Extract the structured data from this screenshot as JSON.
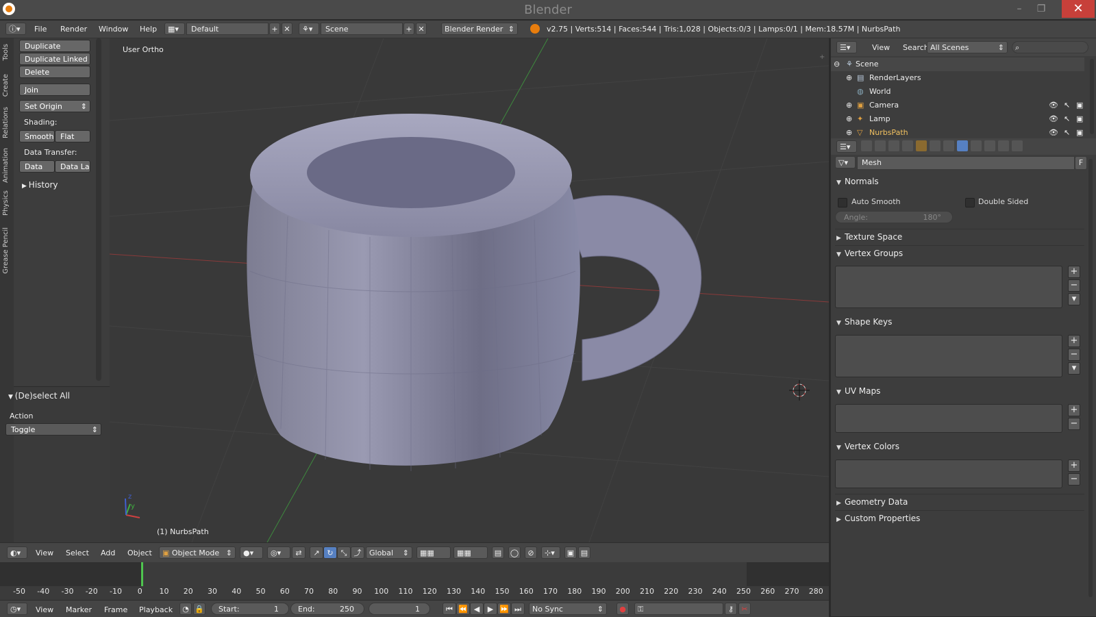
{
  "window": {
    "title": "Blender",
    "minimize_icon": "minimize-icon",
    "maximize_icon": "maximize-icon",
    "close_label": "✕"
  },
  "infobar": {
    "menus": [
      "File",
      "Render",
      "Window",
      "Help"
    ],
    "layout": "Default",
    "scene": "Scene",
    "engine": "Blender Render",
    "stats": "v2.75 | Verts:514 | Faces:544 | Tris:1,028 | Objects:0/3 | Lamps:0/1 | Mem:18.57M | NurbsPath"
  },
  "toolshelf": {
    "tabs": [
      "Tools",
      "Create",
      "Relations",
      "Animation",
      "Physics",
      "Grease Pencil"
    ],
    "duplicate": "Duplicate",
    "duplicate_linked": "Duplicate Linked",
    "delete": "Delete",
    "join": "Join",
    "set_origin": "Set Origin",
    "shading_label": "Shading:",
    "smooth": "Smooth",
    "flat": "Flat",
    "data_transfer_label": "Data Transfer:",
    "data": "Data",
    "data_layout": "Data La",
    "history": "History",
    "operator_title": "(De)select All",
    "action_label": "Action",
    "action_value": "Toggle"
  },
  "viewport": {
    "view_label": "User Ortho",
    "object_label": "(1) NurbsPath",
    "axis_y": "y",
    "axis_z": "z"
  },
  "viewheader": {
    "menus": [
      "View",
      "Select",
      "Add",
      "Object"
    ],
    "mode": "Object Mode",
    "orientation": "Global"
  },
  "timeline": {
    "ticks": [
      "-50",
      "-40",
      "-30",
      "-20",
      "-10",
      "0",
      "10",
      "20",
      "30",
      "40",
      "50",
      "60",
      "70",
      "80",
      "90",
      "100",
      "110",
      "120",
      "130",
      "140",
      "150",
      "160",
      "170",
      "180",
      "190",
      "200",
      "210",
      "220",
      "230",
      "240",
      "250",
      "260",
      "270",
      "280"
    ],
    "menus": [
      "View",
      "Marker",
      "Frame",
      "Playback"
    ],
    "start_label": "Start:",
    "start_value": "1",
    "end_label": "End:",
    "end_value": "250",
    "current_frame": "1",
    "sync": "No Sync"
  },
  "outliner": {
    "menus": [
      "View",
      "Search"
    ],
    "display": "All Scenes",
    "items": [
      {
        "label": "Scene",
        "icon": "scene-icon"
      },
      {
        "label": "RenderLayers",
        "icon": "render-layers-icon"
      },
      {
        "label": "World",
        "icon": "world-icon"
      },
      {
        "label": "Camera",
        "icon": "camera-icon"
      },
      {
        "label": "Lamp",
        "icon": "lamp-icon"
      },
      {
        "label": "NurbsPath",
        "icon": "curve-icon"
      }
    ]
  },
  "properties": {
    "mesh_name": "Mesh",
    "fake_user": "F",
    "normals": "Normals",
    "auto_smooth": "Auto Smooth",
    "double_sided": "Double Sided",
    "angle_label": "Angle:",
    "angle_value": "180°",
    "texture_space": "Texture Space",
    "vertex_groups": "Vertex Groups",
    "shape_keys": "Shape Keys",
    "uv_maps": "UV Maps",
    "vertex_colors": "Vertex Colors",
    "geometry_data": "Geometry Data",
    "custom_properties": "Custom Properties"
  },
  "colors": {
    "accent": "#5680c2",
    "close": "#c7403a",
    "mesh": "#8c8ca8",
    "grid": "#454545"
  }
}
